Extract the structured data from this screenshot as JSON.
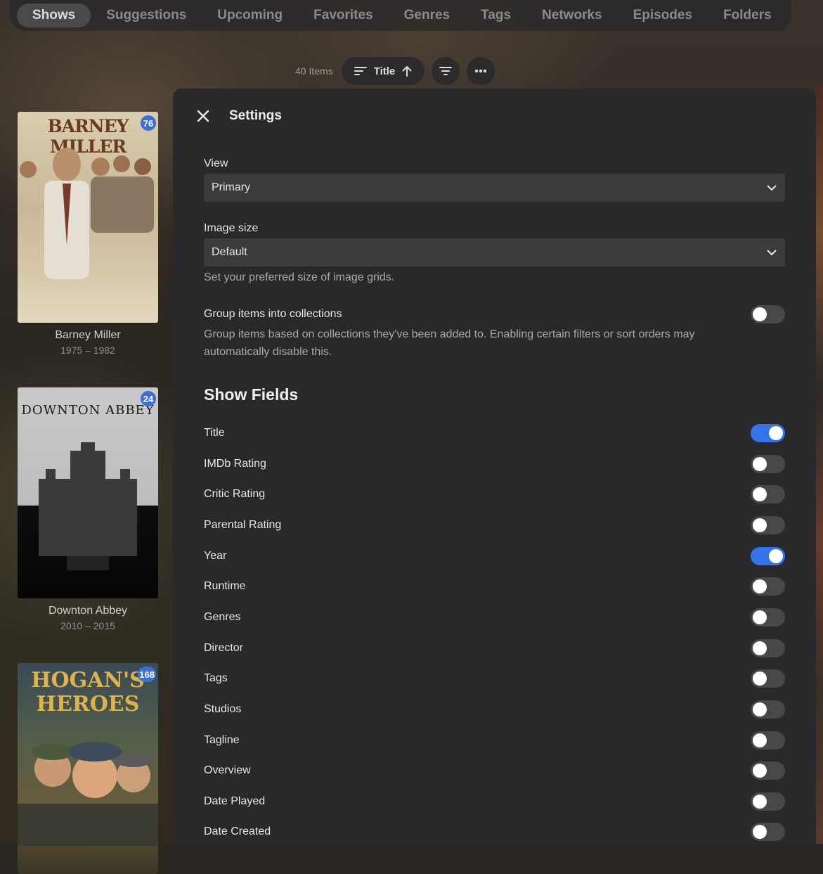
{
  "nav": {
    "tabs": [
      "Shows",
      "Suggestions",
      "Upcoming",
      "Favorites",
      "Genres",
      "Tags",
      "Networks",
      "Episodes",
      "Folders"
    ],
    "active_tab": "Shows"
  },
  "toolbar": {
    "items_count": "40 Items",
    "sort_label": "Title",
    "sort_direction_icon": "arrow-up-icon",
    "filter_icon": "filter-icon",
    "more_icon": "more-horizontal-icon"
  },
  "shows": [
    {
      "title": "Barney Miller",
      "years": "1975 – 1982",
      "badge": "76",
      "poster_text": "BARNEY MILLER"
    },
    {
      "title": "Downton Abbey",
      "years": "2010 – 2015",
      "badge": "24",
      "poster_text": "DOWNTON ABBEY"
    },
    {
      "title": "Hogan's Heroes",
      "badge": "168",
      "poster_text": "HOGAN'S HEROES"
    }
  ],
  "settings": {
    "title": "Settings",
    "view": {
      "label": "View",
      "value": "Primary"
    },
    "image_size": {
      "label": "Image size",
      "value": "Default",
      "help": "Set your preferred size of image grids."
    },
    "group": {
      "label": "Group items into collections",
      "help": "Group items based on collections they've been added to. Enabling certain filters or sort orders may automatically disable this.",
      "enabled": false
    },
    "show_fields_title": "Show Fields",
    "fields": [
      {
        "label": "Title",
        "enabled": true
      },
      {
        "label": "IMDb Rating",
        "enabled": false
      },
      {
        "label": "Critic Rating",
        "enabled": false
      },
      {
        "label": "Parental Rating",
        "enabled": false
      },
      {
        "label": "Year",
        "enabled": true
      },
      {
        "label": "Runtime",
        "enabled": false
      },
      {
        "label": "Genres",
        "enabled": false
      },
      {
        "label": "Director",
        "enabled": false
      },
      {
        "label": "Tags",
        "enabled": false
      },
      {
        "label": "Studios",
        "enabled": false
      },
      {
        "label": "Tagline",
        "enabled": false
      },
      {
        "label": "Overview",
        "enabled": false
      },
      {
        "label": "Date Played",
        "enabled": false
      },
      {
        "label": "Date Created",
        "enabled": false
      }
    ]
  },
  "colors": {
    "accent": "#3574e8",
    "panel": "#29292b",
    "badge": "#3a6fd8"
  }
}
